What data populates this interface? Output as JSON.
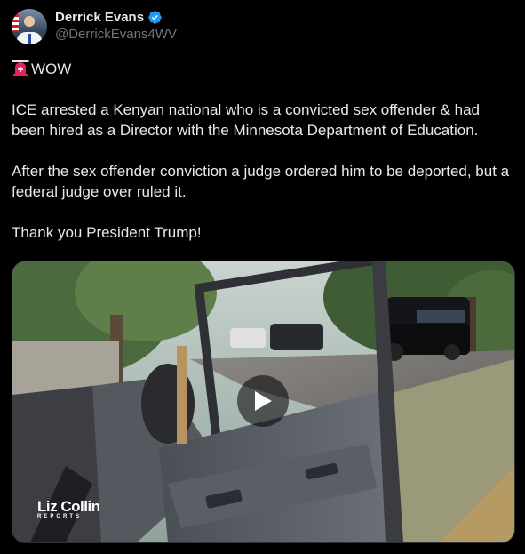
{
  "author": {
    "display_name": "Derrick Evans",
    "handle": "@DerrickEvans4WV",
    "verified": true,
    "verified_color": "#1d9bf0"
  },
  "post": {
    "headline": "WOW",
    "headline_icon": "police-siren-emoji",
    "paragraphs": [
      "ICE arrested a Kenyan national who is a convicted sex offender & had been hired as a Director with the Minnesota Department of Education.",
      "After the sex offender conviction a judge ordered him to be deported, but a federal judge over ruled it.",
      "Thank you President Trump!"
    ]
  },
  "media": {
    "type": "video",
    "play_icon": "play-icon",
    "watermark_main": "Liz Collin",
    "watermark_sub": "REPORTS"
  },
  "colors": {
    "background": "#000000",
    "text": "#e7e9ea",
    "secondary_text": "#71767b",
    "border": "#2f3336",
    "siren_red": "#e0245e"
  }
}
